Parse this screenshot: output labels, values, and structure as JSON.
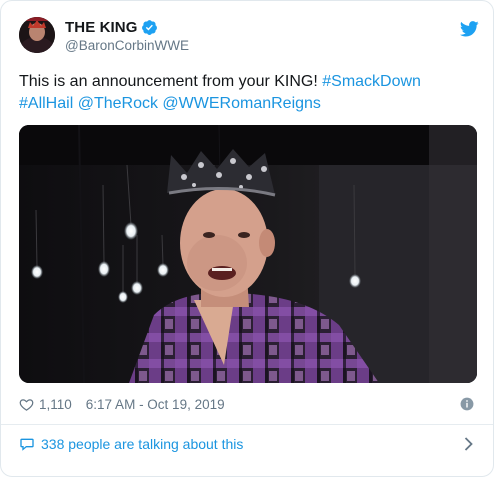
{
  "user": {
    "display_name": "THE KING",
    "handle": "@BaronCorbinWWE",
    "verified": true
  },
  "tweet": {
    "text_plain_1": "This is an announcement from your KING! ",
    "link_1": "#SmackDown",
    "link_2": "#AllHail",
    "link_3": "@TheRock",
    "link_4": "@WWERomanReigns"
  },
  "meta": {
    "like_count": "1,110",
    "timestamp": "6:17 AM - Oct 19, 2019"
  },
  "conversation": {
    "label": "338 people are talking about this"
  },
  "icons": {
    "avatar": "avatar-photo",
    "verified": "verified-badge-icon",
    "brand": "twitter-bird-icon",
    "like": "heart-icon",
    "info": "info-icon",
    "conversation": "speech-bubble-icon",
    "chevron": "chevron-right-icon",
    "media": "video-still"
  },
  "colors": {
    "link": "#1b95e0",
    "text": "#14171a",
    "muted": "#657786",
    "border": "#e1e8ed"
  }
}
